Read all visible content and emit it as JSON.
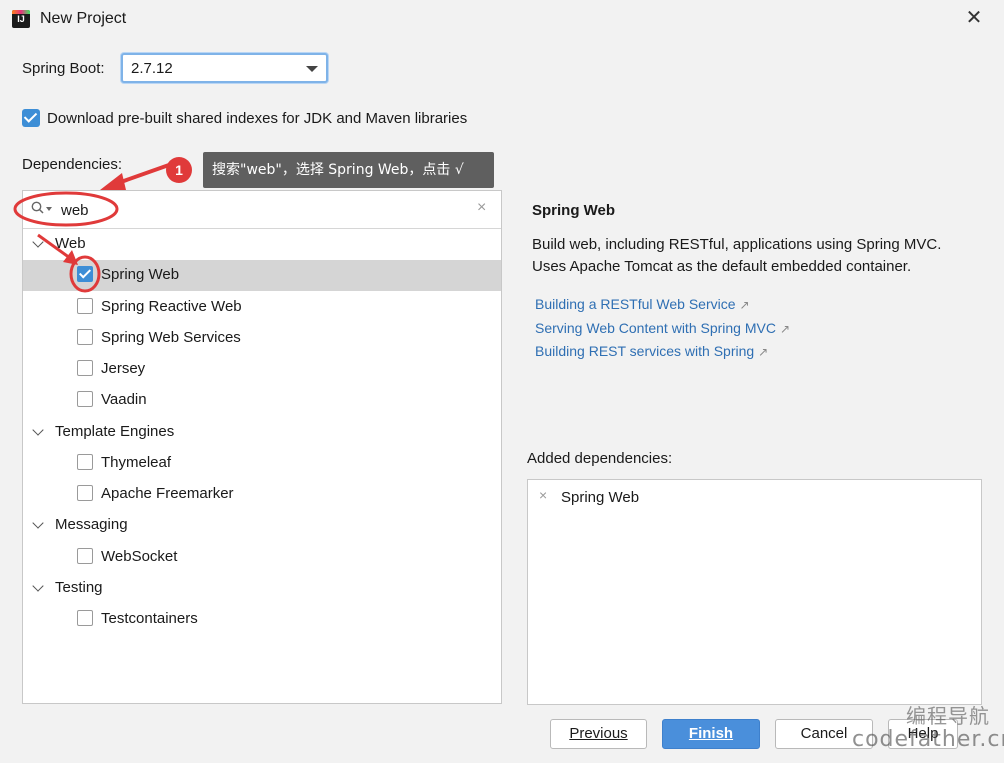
{
  "window": {
    "title": "New Project",
    "app_icon_text": "IJ"
  },
  "spring_boot": {
    "label": "Spring Boot:",
    "selected": "2.7.12"
  },
  "download_indexes": {
    "checked": true,
    "label": "Download pre-built shared indexes for JDK and Maven libraries"
  },
  "dependencies": {
    "label": "Dependencies:",
    "search": {
      "value": "web",
      "clear_glyph": "×"
    },
    "tree": [
      {
        "group": "Web",
        "items": [
          {
            "label": "Spring Web",
            "checked": true,
            "selected": true
          },
          {
            "label": "Spring Reactive Web",
            "checked": false
          },
          {
            "label": "Spring Web Services",
            "checked": false
          },
          {
            "label": "Jersey",
            "checked": false
          },
          {
            "label": "Vaadin",
            "checked": false
          }
        ]
      },
      {
        "group": "Template Engines",
        "items": [
          {
            "label": "Thymeleaf",
            "checked": false
          },
          {
            "label": "Apache Freemarker",
            "checked": false
          }
        ]
      },
      {
        "group": "Messaging",
        "items": [
          {
            "label": "WebSocket",
            "checked": false
          }
        ]
      },
      {
        "group": "Testing",
        "items": [
          {
            "label": "Testcontainers",
            "checked": false
          }
        ]
      }
    ]
  },
  "annotation": {
    "step": "1",
    "tooltip": "搜索\"web\"，选择 Spring Web，点击 √",
    "color": "#e03a3a"
  },
  "detail": {
    "title": "Spring Web",
    "description_line1": "Build web, including RESTful, applications using Spring MVC.",
    "description_line2": "Uses Apache Tomcat as the default embedded container.",
    "links": [
      "Building a RESTful Web Service",
      "Serving Web Content with Spring MVC",
      "Building REST services with Spring"
    ],
    "link_icon": "↗"
  },
  "added": {
    "label": "Added dependencies:",
    "items": [
      "Spring Web"
    ],
    "remove_glyph": "×"
  },
  "buttons": {
    "previous": "Previous",
    "finish": "Finish",
    "cancel": "Cancel",
    "help": "Help"
  },
  "watermark": {
    "line1": "编程导航",
    "line2": "codefather.cn"
  },
  "colors": {
    "accent": "#3d8ed6",
    "link": "#2f6fb3",
    "primary_button": "#4a8fdb",
    "selection": "#d5d5d5"
  }
}
